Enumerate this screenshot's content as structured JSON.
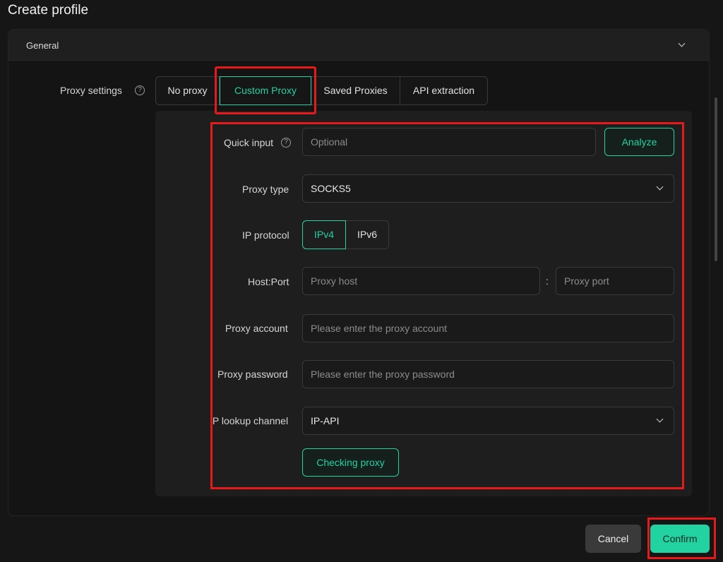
{
  "window": {
    "title": "Create profile"
  },
  "section": {
    "title": "General"
  },
  "proxy_settings": {
    "label": "Proxy settings",
    "help": "?",
    "tabs": [
      {
        "label": "No proxy"
      },
      {
        "label": "Custom Proxy",
        "selected": true
      },
      {
        "label": "Saved Proxies"
      },
      {
        "label": "API extraction"
      }
    ]
  },
  "form": {
    "quick_input": {
      "label": "Quick input",
      "help": "?",
      "placeholder": "Optional",
      "button": "Analyze"
    },
    "proxy_type": {
      "label": "Proxy type",
      "value": "SOCKS5"
    },
    "ip_protocol": {
      "label": "IP protocol",
      "options": [
        "IPv4",
        "IPv6"
      ],
      "selected": "IPv4"
    },
    "host_port": {
      "label": "Host:Port",
      "host_placeholder": "Proxy host",
      "separator": ":",
      "port_placeholder": "Proxy port"
    },
    "proxy_account": {
      "label": "Proxy account",
      "placeholder": "Please enter the proxy account"
    },
    "proxy_password": {
      "label": "Proxy password",
      "placeholder": "Please enter the proxy password"
    },
    "ip_lookup": {
      "label": "IP lookup channel",
      "value": "IP-API"
    },
    "check_button": "Checking proxy"
  },
  "footer": {
    "cancel": "Cancel",
    "confirm": "Confirm"
  },
  "colors": {
    "accent": "#22d3a1",
    "highlight": "#e8191a",
    "background": "#161616"
  },
  "icons": [
    "chevron-down-icon",
    "help-icon"
  ]
}
